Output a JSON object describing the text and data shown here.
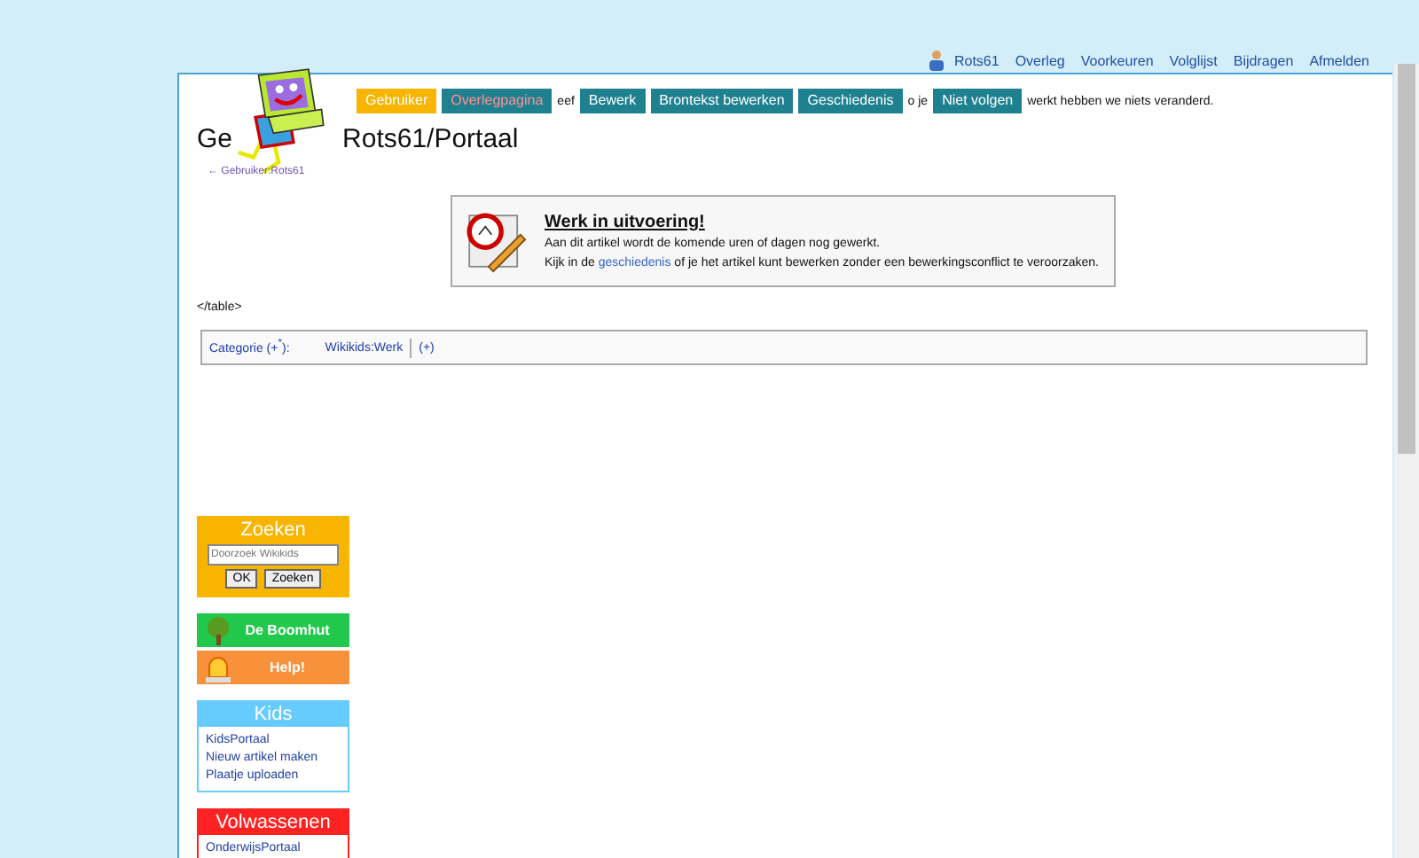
{
  "personal_links": [
    {
      "label": "Rots61",
      "kind": "user"
    },
    {
      "label": "Overleg",
      "kind": "link"
    },
    {
      "label": "Voorkeuren",
      "kind": "link"
    },
    {
      "label": "Volglijst",
      "kind": "link"
    },
    {
      "label": "Bijdragen",
      "kind": "link"
    },
    {
      "label": "Afmelden",
      "kind": "link"
    }
  ],
  "tab_row": [
    {
      "kind": "tab",
      "label": "Gebruiker",
      "selected": true
    },
    {
      "kind": "tab",
      "label": "Overlegpagina",
      "selected": false,
      "missing": true
    },
    {
      "kind": "text",
      "label": "eef"
    },
    {
      "kind": "tab",
      "label": "Bewerk",
      "selected": false,
      "missing": false
    },
    {
      "kind": "tab",
      "label": "Brontekst bewerken",
      "selected": false,
      "missing": false
    },
    {
      "kind": "tab",
      "label": "Geschiedenis",
      "selected": false,
      "missing": false
    },
    {
      "kind": "text",
      "label": "o je"
    },
    {
      "kind": "tab",
      "label": "Niet volgen",
      "selected": false,
      "missing": false
    },
    {
      "kind": "text",
      "label": "werkt hebben we niets veranderd."
    }
  ],
  "title_fragments": [
    "Ge",
    "Rots61/Portaal"
  ],
  "subtitle": "← Gebruiker:Rots61",
  "notice_box": {
    "heading": "Werk in uitvoering!",
    "lines": [
      {
        "text": "Aan dit artikel wordt de komende uren of dagen nog gewerkt."
      },
      {
        "text": "Kijk in de ",
        "link": "geschiedenis",
        "after": " of je het artikel kunt bewerken zonder een bewerkingsconflict te veroorzaken."
      }
    ]
  },
  "raw_text": "</table>",
  "categories": {
    "label": "Categorie (+$^{*}$):",
    "items": [
      "Wikikids:Werk",
      "(+)"
    ]
  },
  "sidebar": {
    "search": {
      "title": "Zoeken",
      "placeholder": "Doorzoek Wikikids",
      "buttons": [
        "OK",
        "Zoeken"
      ]
    },
    "link_buttons": [
      {
        "label": "De Boomhut",
        "kind": "tree",
        "color": "#22c84c"
      },
      {
        "label": "Help!",
        "kind": "siren",
        "color": "#f7913a"
      }
    ],
    "panels": [
      {
        "title": "Kids",
        "color": "#66ccff",
        "links": [
          "KidsPortaal",
          "Nieuw artikel maken",
          "Plaatje uploaden"
        ]
      },
      {
        "title": "Volwassenen",
        "color": "#ff2222",
        "links": [
          "OnderwijsPortaal"
        ]
      }
    ]
  }
}
